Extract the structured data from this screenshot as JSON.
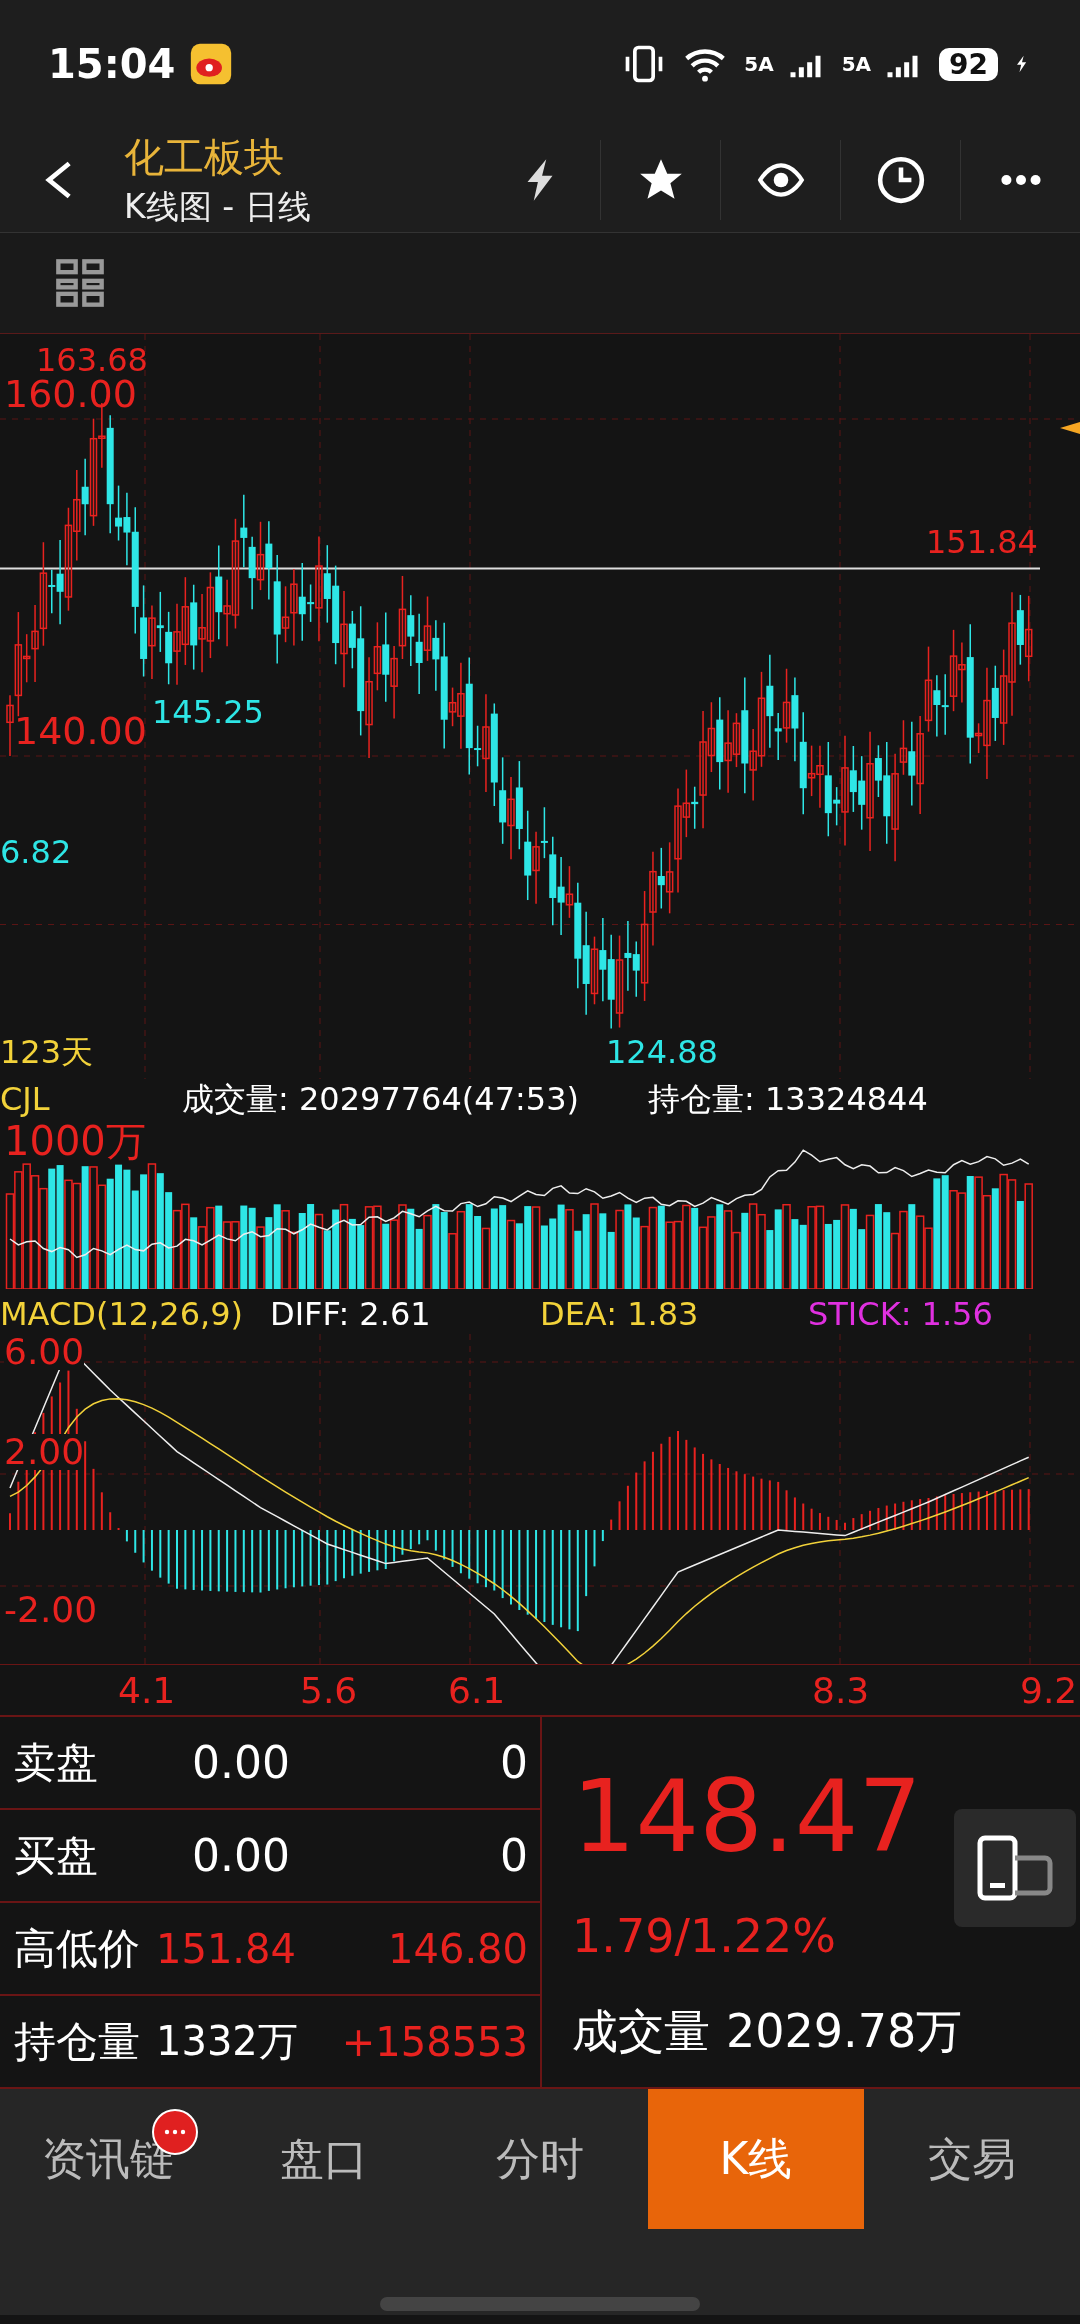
{
  "status_bar": {
    "time": "15:04",
    "signal_labels": [
      "5A",
      "5A"
    ],
    "battery": "92"
  },
  "header": {
    "title": "化工板块",
    "subtitle": "K线图 - 日线"
  },
  "price_chart": {
    "max_label": "163.68",
    "axis_labels": [
      "160.00",
      "140.00"
    ],
    "last_high": "151.84",
    "swing_low_label": "145.25",
    "left_label": "6.82",
    "min_label": "124.88",
    "days": "123天"
  },
  "volume": {
    "title": "CJL",
    "volume": "成交量: 20297764(47:53)",
    "open_interest": "持仓量: 13324844",
    "axis_label": "1000万"
  },
  "macd": {
    "title": "MACD(12,26,9)",
    "diff": "DIFF: 2.61",
    "dea": "DEA: 1.83",
    "stick": "STICK: 1.56",
    "axis_labels": [
      "6.00",
      "2.00",
      "-2.00"
    ]
  },
  "dates": [
    "4.1",
    "5.6",
    "6.1",
    "8.3",
    "9.2"
  ],
  "quote_rows": [
    {
      "kind": "plain",
      "label": "卖盘",
      "value": "0.00",
      "extra": "0"
    },
    {
      "kind": "plain",
      "label": "买盘",
      "value": "0.00",
      "extra": "0"
    },
    {
      "kind": "price",
      "label": "高低价",
      "value": "151.84",
      "extra": "146.80"
    },
    {
      "kind": "interest",
      "label": "持仓量",
      "value": "1332万",
      "extra": "+158553"
    }
  ],
  "quote": {
    "last_price": "148.47",
    "change": "1.79/1.22%",
    "turnover_label": "成交量",
    "turnover": "2029.78万"
  },
  "tabs": [
    {
      "label": "资讯链",
      "selected": false,
      "badge": true
    },
    {
      "label": "盘口",
      "selected": false,
      "badge": false
    },
    {
      "label": "分时",
      "selected": false,
      "badge": false
    },
    {
      "label": "K线",
      "selected": true,
      "badge": false
    },
    {
      "label": "交易",
      "selected": false,
      "badge": false
    }
  ]
}
